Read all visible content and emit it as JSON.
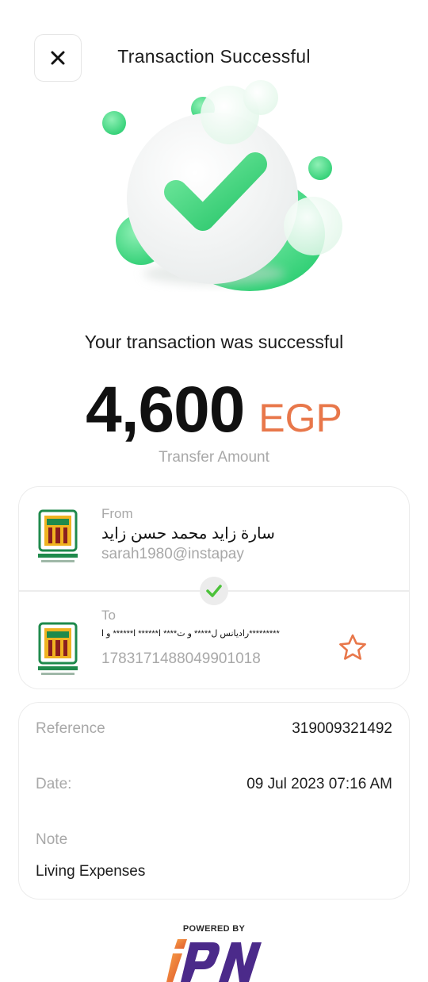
{
  "header": {
    "title": "Transaction Successful",
    "close_icon": "close-icon"
  },
  "hero": {
    "icon": "success-check-illustration",
    "accent": "#3ddc84"
  },
  "summary": {
    "message": "Your transaction was successful",
    "amount": "4,600",
    "currency": "EGP",
    "amount_label": "Transfer Amount"
  },
  "from": {
    "caption": "From",
    "name": "سارة زايد محمد حسن زايد",
    "handle": "sarah1980@instapay",
    "bank_logo": "national-bank-of-egypt-logo"
  },
  "to": {
    "caption": "To",
    "name": "راديانس ل***** و ت**** ا****** ا****** و ا*********",
    "account": "1783171488049901018",
    "bank_logo": "national-bank-of-egypt-logo",
    "favorite_icon": "star-outline-icon"
  },
  "details": {
    "reference_label": "Reference",
    "reference_value": "319009321492",
    "date_label": "Date:",
    "date_value": "09 Jul 2023 07:16 AM",
    "note_label": "Note",
    "note_value": "Living Expenses"
  },
  "footer": {
    "powered_by": "POWERED BY",
    "logo": "ipn-logo"
  },
  "colors": {
    "accent_orange": "#e8774a",
    "success_green": "#3ddc84",
    "muted_text": "#a8a8a8"
  }
}
